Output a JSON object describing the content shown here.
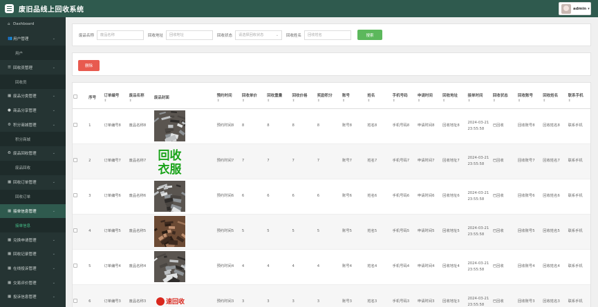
{
  "app": {
    "title": "废旧品线上回收系统",
    "user": "admin"
  },
  "sidebar": {
    "items": [
      {
        "label": "Dashboard",
        "icon": "home-icon",
        "type": "item"
      },
      {
        "label": "用户管理",
        "icon": "user-group-icon",
        "type": "item",
        "chevron": true
      },
      {
        "label": "用户",
        "type": "sub"
      },
      {
        "label": "回收员管理",
        "icon": "list-icon",
        "type": "item",
        "chevron": true
      },
      {
        "label": "回收员",
        "type": "sub"
      },
      {
        "label": "废品分类管理",
        "icon": "grid-icon",
        "type": "item",
        "chevron": true
      },
      {
        "label": "商品分享管理",
        "icon": "user-icon",
        "type": "item",
        "chevron": true
      },
      {
        "label": "积分商城管理",
        "icon": "gear-icon",
        "type": "item",
        "chevron": true
      },
      {
        "label": "积分商城",
        "type": "sub"
      },
      {
        "label": "废品回收管理",
        "icon": "recycle-icon",
        "type": "item",
        "chevron": true
      },
      {
        "label": "废品回收",
        "type": "sub"
      },
      {
        "label": "回收订单管理",
        "icon": "grid-icon",
        "type": "item",
        "chevron": true
      },
      {
        "label": "回收订单",
        "type": "sub"
      },
      {
        "label": "接单信息管理",
        "icon": "grid-icon",
        "type": "item",
        "chevron": true,
        "active": true
      },
      {
        "label": "接单信息",
        "type": "sub",
        "active": true
      },
      {
        "label": "兑换申请管理",
        "icon": "grid-icon",
        "type": "item",
        "chevron": true
      },
      {
        "label": "回收记录管理",
        "icon": "grid-icon",
        "type": "item",
        "chevron": true
      },
      {
        "label": "在线投诉管理",
        "icon": "grid-icon",
        "type": "item",
        "chevron": true
      },
      {
        "label": "交易评价管理",
        "icon": "grid-icon",
        "type": "item",
        "chevron": true
      },
      {
        "label": "投诉信息管理",
        "icon": "grid-icon",
        "type": "item",
        "chevron": true
      }
    ]
  },
  "search": {
    "label_name": "废品名称",
    "placeholder_name": "废品名称",
    "label_addr": "回收地址",
    "placeholder_addr": "回收地址",
    "label_status": "回收状态",
    "placeholder_status": "请选择回收状态",
    "label_person": "回收姓名",
    "placeholder_person": "回收姓名",
    "button": "搜索"
  },
  "actions": {
    "delete": "删除"
  },
  "table": {
    "headers": [
      "序号",
      "订单编号",
      "废品名称",
      "废品封面",
      "预约时间",
      "回收单价",
      "回收重量",
      "回收价格",
      "奖励积分",
      "账号",
      "姓名",
      "手机号码",
      "申请时间",
      "回收地址",
      "接单时间",
      "回收状态",
      "回收账号",
      "回收姓名",
      "联系手机"
    ],
    "rows": [
      {
        "idx": "1",
        "order": "订单编号8",
        "name": "废品名称8",
        "img": "scrap",
        "appt": "预约时间8",
        "price": "8",
        "weight": "8",
        "total": "8",
        "points": "8",
        "acct": "账号8",
        "uname": "姓名8",
        "phone": "手机号码8",
        "apply": "申请时间8",
        "addr": "回收地址8",
        "taken": "2024-03-21 23:55:58",
        "status": "已回收",
        "racct": "回收账号8",
        "rname": "回收姓名8",
        "rphone": "联系手机"
      },
      {
        "idx": "2",
        "order": "订单编号7",
        "name": "废品名称7",
        "img": "text",
        "img_text": "回收衣服",
        "appt": "预约时间7",
        "price": "7",
        "weight": "7",
        "total": "7",
        "points": "7",
        "acct": "账号7",
        "uname": "姓名7",
        "phone": "手机号码7",
        "apply": "申请时间7",
        "addr": "回收地址7",
        "taken": "2024-03-21 23:55:58",
        "status": "已回收",
        "racct": "回收账号7",
        "rname": "回收姓名7",
        "rphone": "联系手机"
      },
      {
        "idx": "3",
        "order": "订单编号6",
        "name": "废品名称6",
        "img": "scrap",
        "appt": "预约时间6",
        "price": "6",
        "weight": "6",
        "total": "6",
        "points": "6",
        "acct": "账号6",
        "uname": "姓名6",
        "phone": "手机号码6",
        "apply": "申请时间6",
        "addr": "回收地址6",
        "taken": "2024-03-21 23:55:58",
        "status": "已回收",
        "racct": "回收账号6",
        "rname": "回收姓名6",
        "rphone": "联系手机"
      },
      {
        "idx": "4",
        "order": "订单编号5",
        "name": "废品名称5",
        "img": "wood",
        "appt": "预约时间5",
        "price": "5",
        "weight": "5",
        "total": "5",
        "points": "5",
        "acct": "账号5",
        "uname": "姓名5",
        "phone": "手机号码5",
        "apply": "申请时间5",
        "addr": "回收地址5",
        "taken": "2024-03-21 23:55:58",
        "status": "已回收",
        "racct": "回收账号5",
        "rname": "回收姓名5",
        "rphone": "联系手机"
      },
      {
        "idx": "5",
        "order": "订单编号4",
        "name": "废品名称4",
        "img": "scrap",
        "appt": "预约时间4",
        "price": "4",
        "weight": "4",
        "total": "4",
        "points": "4",
        "acct": "账号4",
        "uname": "姓名4",
        "phone": "手机号码4",
        "apply": "申请时间4",
        "addr": "回收地址4",
        "taken": "2024-03-21 23:55:58",
        "status": "已回收",
        "racct": "回收账号4",
        "rname": "回收姓名4",
        "rphone": "联系手机"
      },
      {
        "idx": "6",
        "order": "订单编号3",
        "name": "废品名称3",
        "img": "logo",
        "img_text": "速回收",
        "appt": "预约时间3",
        "price": "3",
        "weight": "3",
        "total": "3",
        "points": "3",
        "acct": "账号3",
        "uname": "姓名3",
        "phone": "手机号码3",
        "apply": "申请时间3",
        "addr": "回收地址3",
        "taken": "2024-03-21 23:55:58",
        "status": "已回收",
        "racct": "回收账号3",
        "rname": "回收姓名3",
        "rphone": "联系手机"
      }
    ]
  },
  "colors": {
    "topbar": "#2f5a4e",
    "sidebar": "#253433",
    "search_btn": "#5cb85c",
    "delete_btn": "#e85a4f",
    "active_sub": "#46c08a"
  }
}
